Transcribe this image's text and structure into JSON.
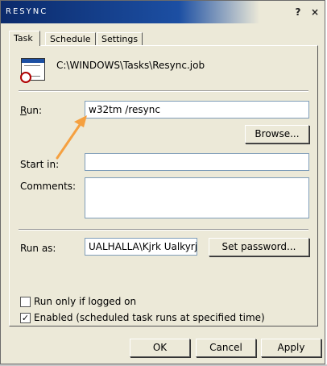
{
  "window": {
    "title": "Resync"
  },
  "title_buttons": {
    "help": "?",
    "close": "×"
  },
  "tabs": [
    {
      "label": "Task",
      "active": true
    },
    {
      "label": "Schedule",
      "active": false
    },
    {
      "label": "Settings",
      "active": false
    }
  ],
  "task": {
    "file_icon": "scheduled-task-file-icon",
    "file_path": "C:\\WINDOWS\\Tasks\\Resync.job",
    "run_label": "Run:",
    "run_value": "w32tm /resync",
    "browse_button": "Browse...",
    "start_in_label": "Start in:",
    "start_in_value": "",
    "comments_label": "Comments:",
    "comments_value": "",
    "run_as_label": "Run as:",
    "run_as_value": "UALHALLA\\Kjrk Ualkyrje",
    "set_password_button": "Set password...",
    "run_only_logged_on": {
      "label": "Run only if logged on",
      "checked": false
    },
    "enabled": {
      "label": "Enabled (scheduled task runs at specified time)",
      "checked": true
    }
  },
  "footer": {
    "ok": "OK",
    "cancel": "Cancel",
    "apply": "Apply"
  },
  "annotation": {
    "arrow_color": "#f5a040"
  },
  "colors": {
    "titlebar": "#0b2a6b",
    "face": "#ece9d8"
  }
}
